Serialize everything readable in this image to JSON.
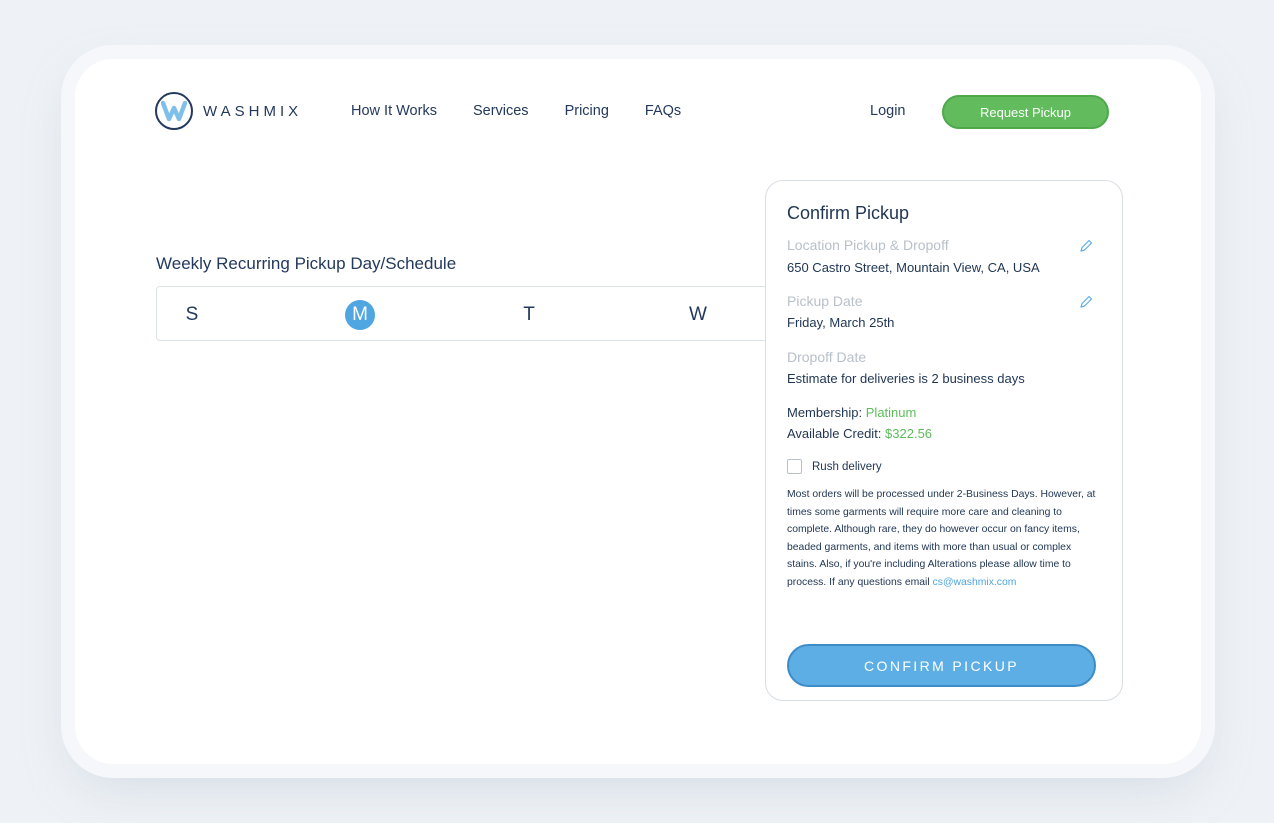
{
  "brand": {
    "name": "WASHMIX",
    "logo_letter": "W",
    "accent_color": "#62bc5e",
    "primary_color": "#5eaee6"
  },
  "nav": {
    "items": [
      "How It Works",
      "Services",
      "Pricing",
      "FAQs"
    ],
    "login": "Login",
    "request_pickup": "Request Pickup"
  },
  "schedule": {
    "title": "Weekly Recurring Pickup Day/Schedule",
    "days": [
      "S",
      "M",
      "T",
      "W"
    ],
    "selected_day": "M"
  },
  "confirm": {
    "title": "Confirm Pickup",
    "location_label": "Location Pickup & Dropoff",
    "location_value": "650 Castro Street, Mountain View, CA, USA",
    "pickup_label": "Pickup Date",
    "pickup_value": "Friday, March 25th",
    "dropoff_label": "Dropoff Date",
    "dropoff_value": "Estimate for deliveries is 2 business days",
    "membership_label": "Membership:",
    "membership_value": "Platinum",
    "credit_label": "Available Credit:",
    "credit_value": "$322.56",
    "rush_label": "Rush delivery",
    "rush_checked": false,
    "notice": "Most orders will be processed under 2-Business Days. However, at times some garments will require more care and cleaning to complete. Although rare, they do however occur on fancy items, beaded garments, and items with more than usual or complex stains. Also, if you're including Alterations please allow time to process. If any questions email",
    "email": "cs@washmix.com",
    "button": "CONFIRM PICKUP"
  }
}
